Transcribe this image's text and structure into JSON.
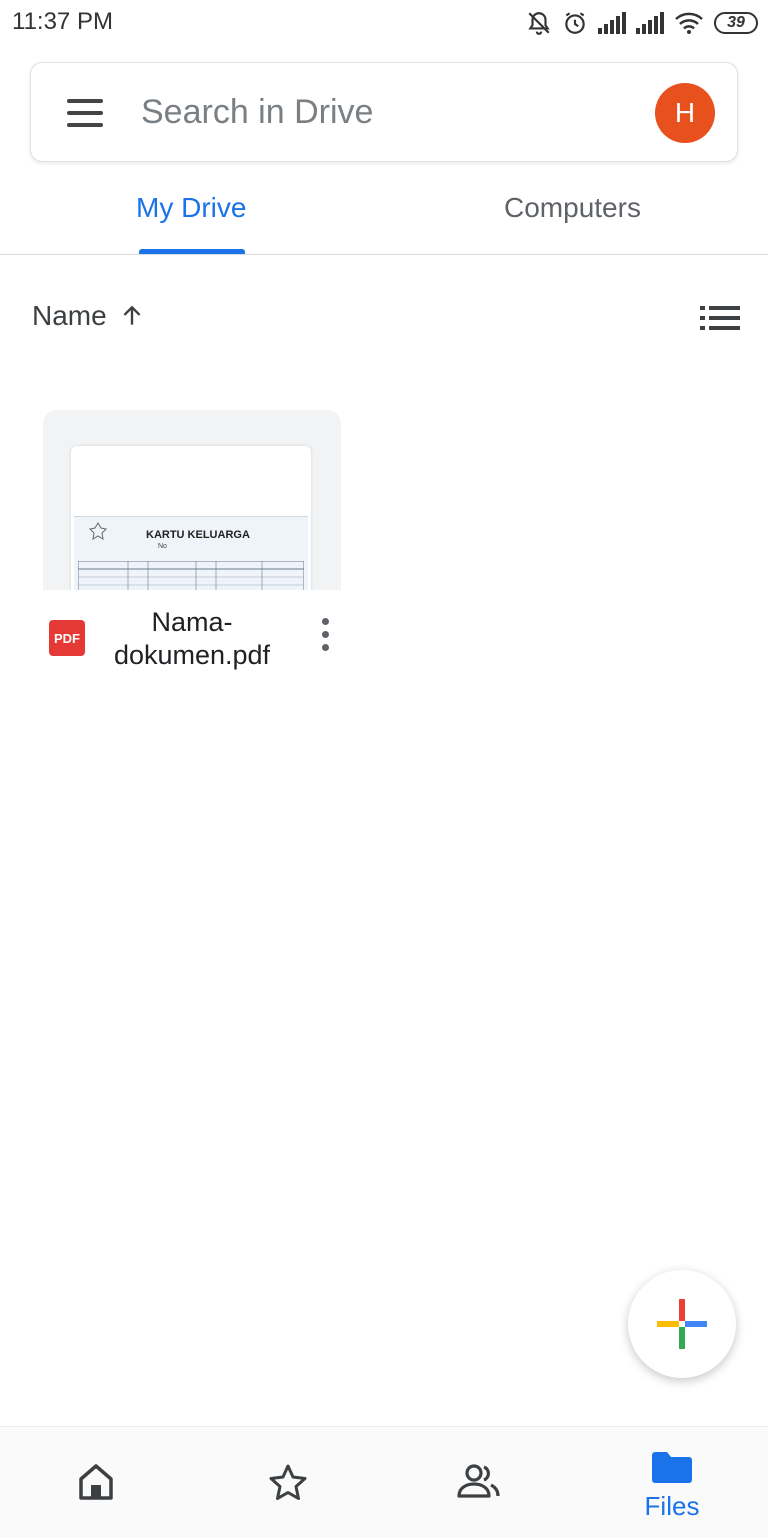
{
  "status_bar": {
    "time": "11:37 PM",
    "battery": "39"
  },
  "search": {
    "placeholder": "Search in Drive",
    "avatar_initial": "H"
  },
  "tabs": [
    {
      "label": "My Drive",
      "active": true
    },
    {
      "label": "Computers",
      "active": false
    }
  ],
  "sort": {
    "label": "Name",
    "direction": "ascending"
  },
  "files": [
    {
      "name": "Nama-dokumen.pdf",
      "type_badge": "PDF",
      "thumbnail_text": {
        "title": "KARTU KELUARGA",
        "number_prefix": "No"
      }
    }
  ],
  "bottom_nav": [
    {
      "id": "home",
      "label": "",
      "icon": "home-icon"
    },
    {
      "id": "starred",
      "label": "",
      "icon": "star-icon"
    },
    {
      "id": "shared",
      "label": "",
      "icon": "people-icon"
    },
    {
      "id": "files",
      "label": "Files",
      "icon": "folder-icon",
      "active": true
    }
  ],
  "colors": {
    "accent": "#1a73e8",
    "avatar": "#e8501e",
    "pdf": "#e53935"
  }
}
